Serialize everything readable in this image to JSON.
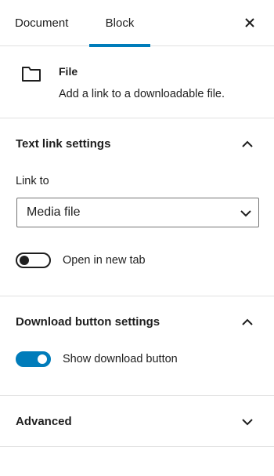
{
  "tabs": {
    "document": "Document",
    "block": "Block",
    "active": "Block"
  },
  "block_card": {
    "icon": "folder-icon",
    "title": "File",
    "description": "Add a link to a downloadable file."
  },
  "text_link_settings": {
    "title": "Text link settings",
    "expanded": true,
    "link_to_label": "Link to",
    "link_to_value": "Media file",
    "new_tab_label": "Open in new tab",
    "new_tab_on": false
  },
  "download_button_settings": {
    "title": "Download button settings",
    "expanded": true,
    "show_label": "Show download button",
    "show_on": true
  },
  "advanced": {
    "title": "Advanced",
    "expanded": false
  },
  "colors": {
    "accent": "#007cba",
    "divider": "#e0e0e0",
    "text": "#1e1e1e"
  }
}
